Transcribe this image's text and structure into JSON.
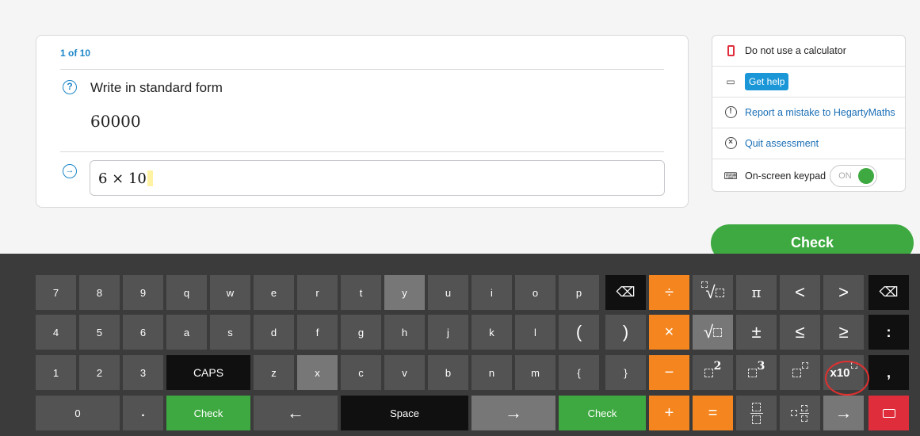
{
  "question": {
    "counter": "1 of 10",
    "help_icon": "?",
    "title": "Write in standard form",
    "value": "60000",
    "answer_icon": "→",
    "answer": "6 × 10"
  },
  "side_panel": {
    "calculator_notice": "Do not use a calculator",
    "get_help": "Get help",
    "report_icon": "!",
    "report": "Report a mistake to HegartyMaths",
    "quit_icon": "×",
    "quit": "Quit assessment",
    "keypad_label": "On-screen keypad",
    "keypad_state": "ON"
  },
  "check_button": "Check",
  "keyboard": {
    "row1": [
      "7",
      "8",
      "9",
      "q",
      "w",
      "e",
      "r",
      "t",
      "y",
      "u",
      "i",
      "o",
      "p",
      "⌫",
      "÷",
      "√",
      "π",
      "<",
      ">",
      "⌫"
    ],
    "row2": [
      "4",
      "5",
      "6",
      "a",
      "s",
      "d",
      "f",
      "g",
      "h",
      "j",
      "k",
      "l",
      "(",
      ")",
      "×",
      "√",
      "±",
      "≤",
      "≥",
      ":"
    ],
    "row3": [
      "1",
      "2",
      "3",
      "CAPS",
      "z",
      "x",
      "c",
      "v",
      "b",
      "n",
      "m",
      "{",
      "}",
      "−",
      "2",
      "3",
      "x10",
      ","
    ],
    "row4": [
      "0",
      ".",
      "Check",
      "←",
      "Space",
      "→",
      "Check",
      "+",
      "=",
      "→"
    ]
  },
  "colors": {
    "accent_blue": "#1b86c9",
    "green": "#3ea940",
    "orange": "#f5861f",
    "red": "#e02d3c"
  }
}
